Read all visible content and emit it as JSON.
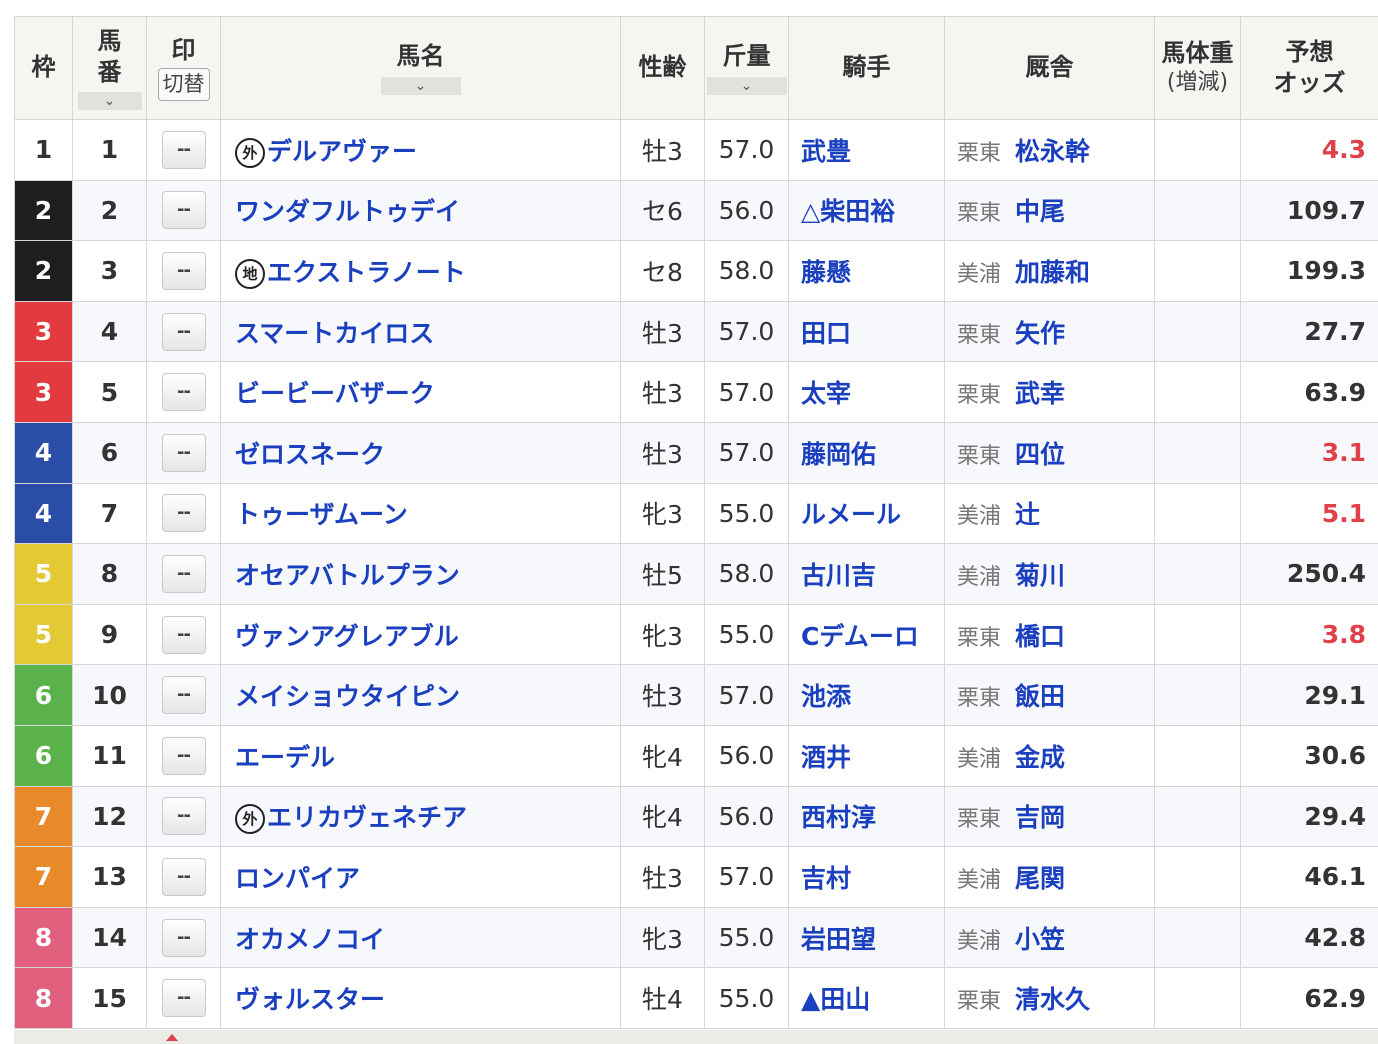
{
  "header": {
    "waku": "枠",
    "umaban_l1": "馬",
    "umaban_l2": "番",
    "sort_glyph": "⌄",
    "mark_l1": "印",
    "mark_toggle": "切替",
    "horse_name": "馬名",
    "sex_age": "性齢",
    "weight": "斤量",
    "jockey": "騎手",
    "trainer": "厩舎",
    "body_weight_l1": "馬体重",
    "body_weight_l2": "(増減)",
    "odds_l1": "予想",
    "odds_l2": "オッズ"
  },
  "mark_placeholder": "--",
  "colors": {
    "frame_1": "#ffffff",
    "frame_2": "#1e1e1e",
    "frame_3": "#e23a3f",
    "frame_4": "#2a4da8",
    "frame_5": "#e3c933",
    "frame_6": "#5bb24a",
    "frame_7": "#e8892a",
    "frame_8": "#e0607e",
    "link": "#1a3fbf",
    "favorite_odds": "#e0404a"
  },
  "rows": [
    {
      "waku": "1",
      "umaban": "1",
      "badge": "外",
      "name": "デルアヴァー",
      "sexage": "牡3",
      "weight": "57.0",
      "jockey": "武豊",
      "area": "栗東",
      "trainer": "松永幹",
      "odds": "4.3",
      "hot": true
    },
    {
      "waku": "2",
      "umaban": "2",
      "badge": "",
      "name": "ワンダフルトゥデイ",
      "sexage": "セ6",
      "weight": "56.0",
      "jockey": "△柴田裕",
      "area": "栗東",
      "trainer": "中尾",
      "odds": "109.7",
      "hot": false
    },
    {
      "waku": "2",
      "umaban": "3",
      "badge": "地",
      "name": "エクストラノート",
      "sexage": "セ8",
      "weight": "58.0",
      "jockey": "藤懸",
      "area": "美浦",
      "trainer": "加藤和",
      "odds": "199.3",
      "hot": false
    },
    {
      "waku": "3",
      "umaban": "4",
      "badge": "",
      "name": "スマートカイロス",
      "sexage": "牡3",
      "weight": "57.0",
      "jockey": "田口",
      "area": "栗東",
      "trainer": "矢作",
      "odds": "27.7",
      "hot": false
    },
    {
      "waku": "3",
      "umaban": "5",
      "badge": "",
      "name": "ビービーバザーク",
      "sexage": "牡3",
      "weight": "57.0",
      "jockey": "太宰",
      "area": "栗東",
      "trainer": "武幸",
      "odds": "63.9",
      "hot": false
    },
    {
      "waku": "4",
      "umaban": "6",
      "badge": "",
      "name": "ゼロスネーク",
      "sexage": "牡3",
      "weight": "57.0",
      "jockey": "藤岡佑",
      "area": "栗東",
      "trainer": "四位",
      "odds": "3.1",
      "hot": true
    },
    {
      "waku": "4",
      "umaban": "7",
      "badge": "",
      "name": "トゥーザムーン",
      "sexage": "牝3",
      "weight": "55.0",
      "jockey": "ルメール",
      "area": "美浦",
      "trainer": "辻",
      "odds": "5.1",
      "hot": true
    },
    {
      "waku": "5",
      "umaban": "8",
      "badge": "",
      "name": "オセアバトルプラン",
      "sexage": "牡5",
      "weight": "58.0",
      "jockey": "古川吉",
      "area": "美浦",
      "trainer": "菊川",
      "odds": "250.4",
      "hot": false
    },
    {
      "waku": "5",
      "umaban": "9",
      "badge": "",
      "name": "ヴァンアグレアブル",
      "sexage": "牝3",
      "weight": "55.0",
      "jockey": "Cデムーロ",
      "area": "栗東",
      "trainer": "橋口",
      "odds": "3.8",
      "hot": true
    },
    {
      "waku": "6",
      "umaban": "10",
      "badge": "",
      "name": "メイショウタイピン",
      "sexage": "牡3",
      "weight": "57.0",
      "jockey": "池添",
      "area": "栗東",
      "trainer": "飯田",
      "odds": "29.1",
      "hot": false
    },
    {
      "waku": "6",
      "umaban": "11",
      "badge": "",
      "name": "エーデル",
      "sexage": "牝4",
      "weight": "56.0",
      "jockey": "酒井",
      "area": "美浦",
      "trainer": "金成",
      "odds": "30.6",
      "hot": false
    },
    {
      "waku": "7",
      "umaban": "12",
      "badge": "外",
      "name": "エリカヴェネチア",
      "sexage": "牝4",
      "weight": "56.0",
      "jockey": "西村淳",
      "area": "栗東",
      "trainer": "吉岡",
      "odds": "29.4",
      "hot": false
    },
    {
      "waku": "7",
      "umaban": "13",
      "badge": "",
      "name": "ロンパイア",
      "sexage": "牡3",
      "weight": "57.0",
      "jockey": "吉村",
      "area": "美浦",
      "trainer": "尾関",
      "odds": "46.1",
      "hot": false
    },
    {
      "waku": "8",
      "umaban": "14",
      "badge": "",
      "name": "オカメノコイ",
      "sexage": "牝3",
      "weight": "55.0",
      "jockey": "岩田望",
      "area": "美浦",
      "trainer": "小笠",
      "odds": "42.8",
      "hot": false
    },
    {
      "waku": "8",
      "umaban": "15",
      "badge": "",
      "name": "ヴォルスター",
      "sexage": "牡4",
      "weight": "55.0",
      "jockey": "▲田山",
      "area": "栗東",
      "trainer": "清水久",
      "odds": "62.9",
      "hot": false
    }
  ]
}
